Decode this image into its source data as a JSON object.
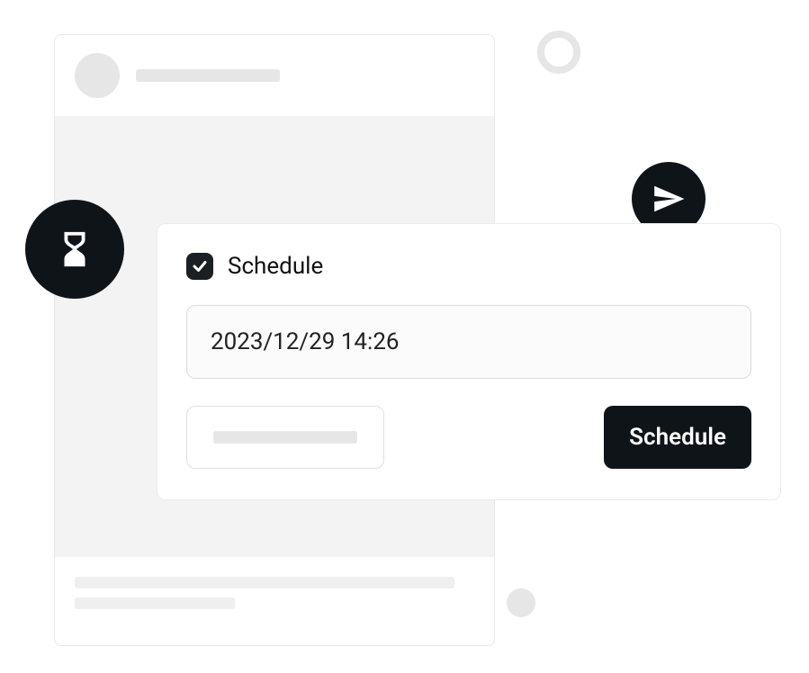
{
  "schedule": {
    "checkbox_checked": true,
    "label": "Schedule",
    "datetime_value": "2023/12/29 14:26",
    "submit_label": "Schedule"
  },
  "icons": {
    "hourglass": "hourglass-icon",
    "send": "paper-plane-icon",
    "check": "check-icon"
  },
  "colors": {
    "accent_dark": "#0f1419",
    "placeholder": "#e6e6e6",
    "surface_muted": "#f3f3f3"
  }
}
